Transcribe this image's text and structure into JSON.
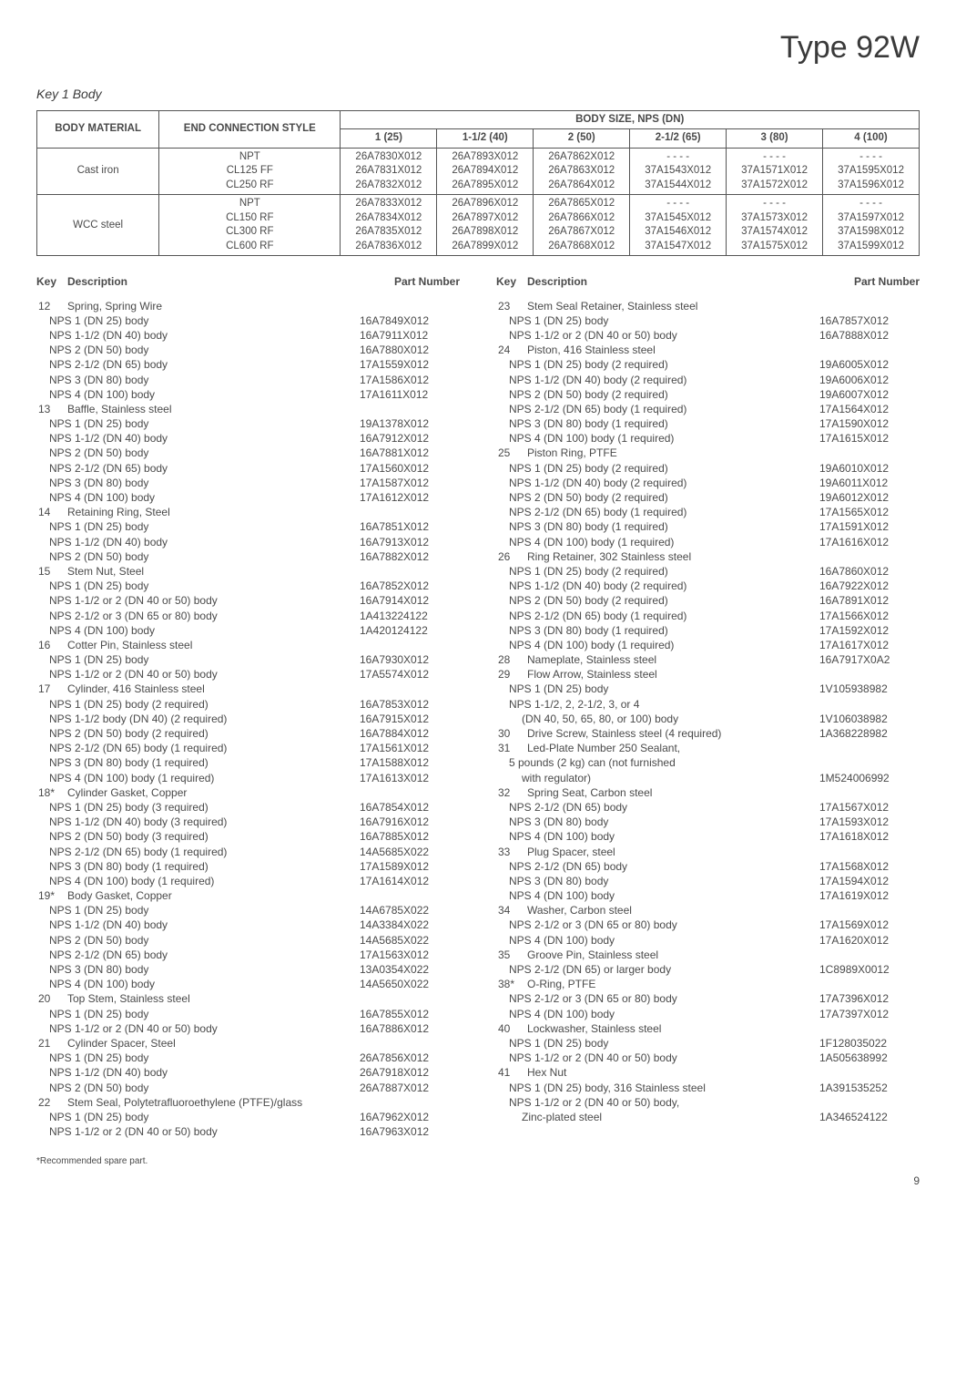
{
  "page": {
    "title": "Type 92W",
    "key_title": "Key 1  Body",
    "footnote": "*Recommended spare part.",
    "page_number": "9"
  },
  "body_table": {
    "headers": {
      "material": "BODY MATERIAL",
      "connection": "END CONNECTION STYLE",
      "size_header": "BODY SIZE, NPS (DN)",
      "sizes": [
        "1 (25)",
        "1-1/2 (40)",
        "2 (50)",
        "2-1/2 (65)",
        "3 (80)",
        "4 (100)"
      ]
    },
    "rows": [
      {
        "material": "Cast iron",
        "connection": "NPT\nCL125 FF\nCL250 RF",
        "cells": [
          "26A7830X012\n26A7831X012\n26A7832X012",
          "26A7893X012\n26A7894X012\n26A7895X012",
          "26A7862X012\n26A7863X012\n26A7864X012",
          "- - - -\n37A1543X012\n37A1544X012",
          "- - - -\n37A1571X012\n37A1572X012",
          "- - - -\n37A1595X012\n37A1596X012"
        ]
      },
      {
        "material": "WCC steel",
        "connection": "NPT\nCL150 RF\nCL300 RF\nCL600 RF",
        "cells": [
          "26A7833X012\n26A7834X012\n26A7835X012\n26A7836X012",
          "26A7896X012\n26A7897X012\n26A7898X012\n26A7899X012",
          "26A7865X012\n26A7866X012\n26A7867X012\n26A7868X012",
          "- - - -\n37A1545X012\n37A1546X012\n37A1547X012",
          "- - - -\n37A1573X012\n37A1574X012\n37A1575X012",
          "- - - -\n37A1597X012\n37A1598X012\n37A1599X012"
        ]
      }
    ]
  },
  "col_headers": {
    "key": "Key",
    "desc": "Description",
    "part": "Part Number"
  },
  "left_items": [
    {
      "key": "12",
      "desc": "Spring, Spring Wire",
      "subs": [
        {
          "d": "NPS 1 (DN 25) body",
          "p": "16A7849X012"
        },
        {
          "d": "NPS 1-1/2 (DN 40) body",
          "p": "16A7911X012"
        },
        {
          "d": "NPS 2 (DN 50) body",
          "p": "16A7880X012"
        },
        {
          "d": "NPS 2-1/2 (DN 65) body",
          "p": "17A1559X012"
        },
        {
          "d": "NPS 3 (DN 80) body",
          "p": "17A1586X012"
        },
        {
          "d": "NPS 4 (DN 100) body",
          "p": "17A1611X012"
        }
      ]
    },
    {
      "key": "13",
      "desc": "Baffle, Stainless steel",
      "subs": [
        {
          "d": "NPS 1 (DN 25) body",
          "p": "19A1378X012"
        },
        {
          "d": "NPS 1-1/2 (DN 40) body",
          "p": "16A7912X012"
        },
        {
          "d": "NPS 2 (DN 50) body",
          "p": "16A7881X012"
        },
        {
          "d": "NPS 2-1/2 (DN 65) body",
          "p": "17A1560X012"
        },
        {
          "d": "NPS 3 (DN 80) body",
          "p": "17A1587X012"
        },
        {
          "d": "NPS 4 (DN 100) body",
          "p": "17A1612X012"
        }
      ]
    },
    {
      "key": "14",
      "desc": "Retaining Ring, Steel",
      "subs": [
        {
          "d": "NPS 1 (DN 25) body",
          "p": "16A7851X012"
        },
        {
          "d": "NPS 1-1/2 (DN 40) body",
          "p": "16A7913X012"
        },
        {
          "d": "NPS 2 (DN 50) body",
          "p": "16A7882X012"
        }
      ]
    },
    {
      "key": "15",
      "desc": "Stem Nut, Steel",
      "subs": [
        {
          "d": "NPS 1 (DN 25) body",
          "p": "16A7852X012"
        },
        {
          "d": "NPS 1-1/2 or 2 (DN 40 or 50) body",
          "p": "16A7914X012"
        },
        {
          "d": "NPS 2-1/2 or 3 (DN 65 or 80) body",
          "p": "1A413224122"
        },
        {
          "d": "NPS 4 (DN 100) body",
          "p": "1A420124122"
        }
      ]
    },
    {
      "key": "16",
      "desc": "Cotter Pin, Stainless steel",
      "subs": [
        {
          "d": "NPS 1 (DN 25) body",
          "p": "16A7930X012"
        },
        {
          "d": "NPS 1-1/2 or 2 (DN 40 or 50) body",
          "p": "17A5574X012"
        }
      ]
    },
    {
      "key": "17",
      "desc": "Cylinder, 416 Stainless steel",
      "subs": [
        {
          "d": "NPS 1 (DN 25) body (2 required)",
          "p": "16A7853X012"
        },
        {
          "d": "NPS 1-1/2 body (DN 40) (2 required)",
          "p": "16A7915X012"
        },
        {
          "d": "NPS 2 (DN 50) body (2 required)",
          "p": "16A7884X012"
        },
        {
          "d": "NPS 2-1/2 (DN 65) body (1 required)",
          "p": "17A1561X012"
        },
        {
          "d": "NPS 3 (DN 80) body (1 required)",
          "p": "17A1588X012"
        },
        {
          "d": "NPS 4 (DN 100) body (1 required)",
          "p": "17A1613X012"
        }
      ]
    },
    {
      "key": "18*",
      "desc": "Cylinder Gasket, Copper",
      "subs": [
        {
          "d": "NPS 1 (DN 25) body (3 required)",
          "p": "16A7854X012"
        },
        {
          "d": "NPS 1-1/2 (DN 40) body (3 required)",
          "p": "16A7916X012"
        },
        {
          "d": "NPS 2 (DN 50) body (3 required)",
          "p": "16A7885X012"
        },
        {
          "d": "NPS 2-1/2 (DN 65) body (1 required)",
          "p": "14A5685X022"
        },
        {
          "d": "NPS 3 (DN 80) body (1 required)",
          "p": "17A1589X012"
        },
        {
          "d": "NPS 4 (DN 100) body (1 required)",
          "p": "17A1614X012"
        }
      ]
    },
    {
      "key": "19*",
      "desc": "Body Gasket, Copper",
      "subs": [
        {
          "d": "NPS 1 (DN 25) body",
          "p": "14A6785X022"
        },
        {
          "d": "NPS 1-1/2 (DN 40) body",
          "p": "14A3384X022"
        },
        {
          "d": "NPS 2 (DN 50) body",
          "p": "14A5685X022"
        },
        {
          "d": "NPS 2-1/2 (DN 65) body",
          "p": "17A1563X012"
        },
        {
          "d": "NPS 3 (DN 80) body",
          "p": "13A0354X022"
        },
        {
          "d": "NPS 4 (DN 100) body",
          "p": "14A5650X022"
        }
      ]
    },
    {
      "key": "20",
      "desc": "Top Stem, Stainless steel",
      "subs": [
        {
          "d": "NPS 1 (DN 25) body",
          "p": "16A7855X012"
        },
        {
          "d": "NPS 1-1/2 or 2 (DN 40 or 50) body",
          "p": "16A7886X012"
        }
      ]
    },
    {
      "key": "21",
      "desc": "Cylinder Spacer, Steel",
      "subs": [
        {
          "d": "NPS 1 (DN 25) body",
          "p": "26A7856X012"
        },
        {
          "d": "NPS 1-1/2 (DN 40) body",
          "p": "26A7918X012"
        },
        {
          "d": "NPS 2 (DN 50) body",
          "p": "26A7887X012"
        }
      ]
    },
    {
      "key": "22",
      "desc": "Stem Seal, Polytetrafluoroethylene (PTFE)/glass",
      "subs": [
        {
          "d": "NPS 1 (DN 25) body",
          "p": "16A7962X012"
        },
        {
          "d": "NPS 1-1/2 or 2 (DN 40 or 50)  body",
          "p": "16A7963X012"
        }
      ]
    }
  ],
  "right_items": [
    {
      "key": "23",
      "desc": "Stem Seal Retainer, Stainless steel",
      "subs": [
        {
          "d": "NPS 1 (DN 25) body",
          "p": "16A7857X012"
        },
        {
          "d": "NPS 1-1/2 or 2 (DN 40 or 50)  body",
          "p": "16A7888X012"
        }
      ]
    },
    {
      "key": "24",
      "desc": "Piston, 416 Stainless steel",
      "subs": [
        {
          "d": "NPS 1 (DN 25) body (2 required)",
          "p": "19A6005X012"
        },
        {
          "d": "NPS 1-1/2 (DN 40) body (2 required)",
          "p": "19A6006X012"
        },
        {
          "d": "NPS 2 (DN 50) body (2 required)",
          "p": "19A6007X012"
        },
        {
          "d": "NPS 2-1/2 (DN 65) body (1 required)",
          "p": "17A1564X012"
        },
        {
          "d": "NPS 3 (DN 80) body (1 required)",
          "p": "17A1590X012"
        },
        {
          "d": "NPS 4 (DN 100) body (1 required)",
          "p": "17A1615X012"
        }
      ]
    },
    {
      "key": "25",
      "desc": "Piston Ring, PTFE",
      "subs": [
        {
          "d": "NPS 1 (DN 25) body (2 required)",
          "p": "19A6010X012"
        },
        {
          "d": "NPS 1-1/2 (DN 40) body (2 required)",
          "p": "19A6011X012"
        },
        {
          "d": "NPS 2 (DN 50) body (2 required)",
          "p": "19A6012X012"
        },
        {
          "d": "NPS 2-1/2 (DN 65) body (1 required)",
          "p": "17A1565X012"
        },
        {
          "d": "NPS 3 (DN 80) body (1 required)",
          "p": "17A1591X012"
        },
        {
          "d": "NPS 4 (DN 100) body (1 required)",
          "p": "17A1616X012"
        }
      ]
    },
    {
      "key": "26",
      "desc": "Ring Retainer, 302 Stainless steel",
      "subs": [
        {
          "d": "NPS 1 (DN 25) body (2 required)",
          "p": "16A7860X012"
        },
        {
          "d": "NPS 1-1/2 (DN 40) body  (2 required)",
          "p": "16A7922X012"
        },
        {
          "d": "NPS 2 (DN 50) body (2 required)",
          "p": "16A7891X012"
        },
        {
          "d": "NPS 2-1/2 (DN 65) body (1 required)",
          "p": "17A1566X012"
        },
        {
          "d": "NPS 3 (DN 80) body (1 required)",
          "p": "17A1592X012"
        },
        {
          "d": "NPS 4 (DN 100) body (1 required)",
          "p": "17A1617X012"
        }
      ]
    },
    {
      "key": "28",
      "desc": "Nameplate, Stainless steel",
      "part": "16A7917X0A2",
      "subs": []
    },
    {
      "key": "29",
      "desc": "Flow Arrow, Stainless steel",
      "subs": [
        {
          "d": "NPS 1 (DN 25) body",
          "p": "1V105938982"
        },
        {
          "d": "NPS 1-1/2, 2, 2-1/2, 3, or 4",
          "p": ""
        },
        {
          "d": "(DN 40, 50, 65, 80, or 100) body",
          "p": "1V106038982",
          "indent": true
        }
      ]
    },
    {
      "key": "30",
      "desc": "Drive Screw, Stainless steel (4 required)",
      "part": "1A368228982",
      "subs": []
    },
    {
      "key": "31",
      "desc": "Led-Plate Number 250 Sealant,",
      "subs": [
        {
          "d": "5 pounds (2 kg) can (not furnished",
          "p": ""
        },
        {
          "d": "with regulator)",
          "p": "1M524006992",
          "indent": true
        }
      ]
    },
    {
      "key": "32",
      "desc": "Spring Seat, Carbon steel",
      "subs": [
        {
          "d": "NPS 2-1/2 (DN 65) body",
          "p": "17A1567X012"
        },
        {
          "d": "NPS 3 (DN 80) body",
          "p": "17A1593X012"
        },
        {
          "d": "NPS 4 (DN 100) body",
          "p": "17A1618X012"
        }
      ]
    },
    {
      "key": "33",
      "desc": "Plug Spacer, steel",
      "subs": [
        {
          "d": "NPS 2-1/2 (DN 65) body",
          "p": "17A1568X012"
        },
        {
          "d": "NPS 3 (DN 80) body",
          "p": "17A1594X012"
        },
        {
          "d": "NPS 4 (DN 100) body",
          "p": "17A1619X012"
        }
      ]
    },
    {
      "key": "34",
      "desc": "Washer, Carbon steel",
      "subs": [
        {
          "d": "NPS 2-1/2 or 3 (DN 65 or 80) body",
          "p": "17A1569X012"
        },
        {
          "d": "NPS 4 (DN 100) body",
          "p": "17A1620X012"
        }
      ]
    },
    {
      "key": "35",
      "desc": "Groove Pin, Stainless steel",
      "subs": [
        {
          "d": "NPS 2-1/2 (DN 65) or larger body",
          "p": "1C8989X0012"
        }
      ]
    },
    {
      "key": "38*",
      "desc": "O-Ring, PTFE",
      "subs": [
        {
          "d": "NPS 2-1/2 or 3 (DN 65 or 80) body",
          "p": "17A7396X012"
        },
        {
          "d": "NPS 4 (DN 100) body",
          "p": "17A7397X012"
        }
      ]
    },
    {
      "key": "40",
      "desc": "Lockwasher, Stainless steel",
      "subs": [
        {
          "d": "NPS 1 (DN 25) body",
          "p": "1F128035022"
        },
        {
          "d": "NPS 1-1/2 or 2 (DN 40 or 50) body",
          "p": "1A505638992"
        }
      ]
    },
    {
      "key": "41",
      "desc": "Hex Nut",
      "subs": [
        {
          "d": "NPS 1 (DN 25) body, 316 Stainless steel",
          "p": "1A391535252"
        },
        {
          "d": "NPS 1-1/2 or 2 (DN 40 or 50) body,",
          "p": ""
        },
        {
          "d": "Zinc-plated steel",
          "p": "1A346524122",
          "indent": true
        }
      ]
    }
  ]
}
